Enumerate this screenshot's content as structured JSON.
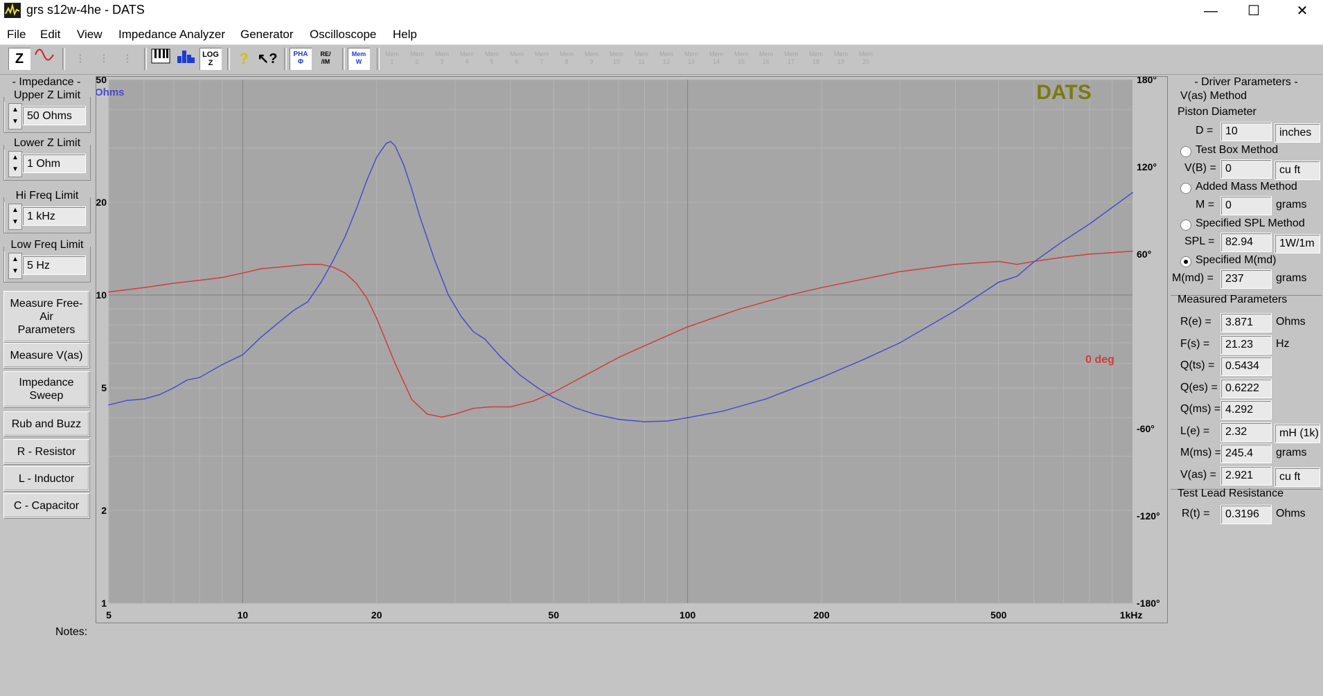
{
  "window": {
    "title": "grs s12w-4he - DATS",
    "minimize": "—",
    "maximize": "☐",
    "close": "✕"
  },
  "menu": [
    "File",
    "Edit",
    "View",
    "Impedance Analyzer",
    "Generator",
    "Oscilloscope",
    "Help"
  ],
  "toolbar": {
    "z_label": "Z",
    "mem_labels": [
      "Mem 1",
      "Mem 2",
      "Mem 3",
      "Mem 4",
      "Mem 5",
      "Mem 6",
      "Mem 7",
      "Mem 8",
      "Mem 9",
      "Mem 10",
      "Mem 11",
      "Mem 12",
      "Mem 13",
      "Mem 14",
      "Mem 15",
      "Mem 16",
      "Mem 17",
      "Mem 18",
      "Mem 19",
      "Mem 20"
    ]
  },
  "left_panel": {
    "impedance_header": "- Impedance -",
    "upper_z": {
      "title": "Upper Z Limit",
      "value": "50 Ohms"
    },
    "lower_z": {
      "title": "Lower Z Limit",
      "value": "1 Ohm"
    },
    "hi_freq": {
      "title": "Hi Freq Limit",
      "value": "1 kHz"
    },
    "low_freq": {
      "title": "Low Freq Limit",
      "value": "5 Hz"
    },
    "buttons": [
      "Measure Free-Air Parameters",
      "Measure V(as)",
      "Impedance Sweep",
      "Rub and Buzz",
      "R - Resistor",
      "L - Inductor",
      "C - Capacitor"
    ]
  },
  "notes_label": "Notes:",
  "right_panel": {
    "header": "- Driver Parameters -",
    "vas_method": "V(as) Method",
    "piston_diameter": "Piston Diameter",
    "d": {
      "label": "D =",
      "value": "10",
      "unit": "inches"
    },
    "test_box": {
      "label": "Test Box Method",
      "field_label": "V(B) =",
      "value": "0",
      "unit": "cu ft",
      "selected": false
    },
    "added_mass": {
      "label": "Added Mass Method",
      "field_label": "M =",
      "value": "0",
      "unit": "grams",
      "selected": false
    },
    "specified_spl": {
      "label": "Specified SPL Method",
      "field_label": "SPL =",
      "value": "82.94",
      "unit": "1W/1m",
      "selected": false
    },
    "specified_mmd": {
      "label": "Specified M(md)",
      "field_label": "M(md) =",
      "value": "237",
      "unit": "grams",
      "selected": true
    },
    "measured_header": "Measured Parameters",
    "measured": [
      {
        "label": "R(e) =",
        "value": "3.871",
        "unit": "Ohms"
      },
      {
        "label": "F(s) =",
        "value": "21.23",
        "unit": "Hz"
      },
      {
        "label": "Q(ts) =",
        "value": "0.5434",
        "unit": ""
      },
      {
        "label": "Q(es) =",
        "value": "0.6222",
        "unit": ""
      },
      {
        "label": "Q(ms) =",
        "value": "4.292",
        "unit": ""
      },
      {
        "label": "L(e) =",
        "value": "2.32",
        "unit": "mH (1k)"
      },
      {
        "label": "M(ms) =",
        "value": "245.4",
        "unit": "grams"
      },
      {
        "label": "V(as) =",
        "value": "2.921",
        "unit": "cu ft"
      }
    ],
    "test_lead_header": "Test Lead Resistance",
    "rt": {
      "label": "R(t) =",
      "value": "0.3196",
      "unit": "Ohms"
    }
  },
  "chart_data": {
    "type": "line",
    "watermark": "DATS",
    "xlabel": "",
    "y_left_unit": "Ohms",
    "y_right_label": "0 deg",
    "x_scale": "log",
    "xlim": [
      5,
      1000
    ],
    "x_ticks": [
      {
        "v": 5,
        "label": "5"
      },
      {
        "v": 10,
        "label": "10"
      },
      {
        "v": 20,
        "label": "20"
      },
      {
        "v": 50,
        "label": "50"
      },
      {
        "v": 100,
        "label": "100"
      },
      {
        "v": 200,
        "label": "200"
      },
      {
        "v": 500,
        "label": "500"
      },
      {
        "v": 1000,
        "label": "1kHz"
      }
    ],
    "y_left_scale": "log",
    "ylim_left": [
      1,
      50
    ],
    "y_left_ticks": [
      {
        "v": 1,
        "label": "1"
      },
      {
        "v": 2,
        "label": "2"
      },
      {
        "v": 5,
        "label": "5"
      },
      {
        "v": 10,
        "label": "10"
      },
      {
        "v": 20,
        "label": "20"
      },
      {
        "v": 50,
        "label": "50"
      }
    ],
    "ylim_right": [
      -180,
      180
    ],
    "y_right_ticks": [
      {
        "v": 180,
        "label": "180°"
      },
      {
        "v": 120,
        "label": "120°"
      },
      {
        "v": 60,
        "label": "60°"
      },
      {
        "v": -60,
        "label": "-60°"
      },
      {
        "v": -120,
        "label": "-120°"
      },
      {
        "v": -180,
        "label": "-180°"
      }
    ],
    "grid": true,
    "colors": {
      "impedance": "#4a4ad0",
      "phase": "#d03c3c",
      "watermark": "#7a7a10",
      "plot_bg": "#a6a6a6"
    },
    "series": [
      {
        "name": "",
        "axis": "left",
        "x": [
          5,
          5.5,
          6,
          6.5,
          7,
          7.5,
          8,
          9,
          10,
          11,
          12,
          13,
          14,
          15,
          16,
          17,
          18,
          19,
          20,
          21,
          21.5,
          22,
          23,
          24,
          25,
          27,
          29,
          31,
          33,
          35,
          38,
          42,
          46,
          50,
          56,
          62,
          70,
          80,
          90,
          100,
          120,
          150,
          200,
          250,
          300,
          400,
          500,
          550,
          600,
          700,
          800,
          1000
        ],
        "y": [
          4.4,
          4.55,
          4.6,
          4.75,
          5.0,
          5.3,
          5.4,
          5.95,
          6.4,
          7.3,
          8.1,
          8.9,
          9.5,
          11.0,
          13.0,
          15.5,
          19.0,
          23.5,
          28.0,
          31.0,
          31.5,
          30.5,
          26.5,
          22.0,
          18.0,
          13.0,
          10.0,
          8.5,
          7.6,
          7.2,
          6.3,
          5.5,
          5.0,
          4.65,
          4.3,
          4.1,
          3.95,
          3.88,
          3.9,
          4.0,
          4.2,
          4.6,
          5.4,
          6.2,
          7.0,
          8.9,
          11.0,
          11.5,
          12.8,
          15.0,
          17.0,
          21.5
        ]
      },
      {
        "name": "",
        "axis": "right",
        "x": [
          5,
          6,
          7,
          8,
          9,
          10,
          11,
          12,
          13,
          14,
          15,
          16,
          17,
          18,
          19,
          20,
          22,
          24,
          26,
          28,
          30,
          33,
          36,
          40,
          45,
          50,
          60,
          70,
          80,
          100,
          130,
          170,
          200,
          250,
          300,
          400,
          500,
          550,
          600,
          700,
          800,
          1000
        ],
        "y": [
          34,
          37,
          40,
          42,
          44,
          47,
          50,
          51,
          52,
          53,
          53,
          51,
          47,
          40,
          30,
          16,
          -15,
          -40,
          -50,
          -52,
          -50,
          -46,
          -45,
          -45,
          -41,
          -35,
          -22,
          -11,
          -3,
          10,
          22,
          32,
          37,
          43,
          48,
          53,
          55,
          53,
          55,
          58,
          60,
          62
        ]
      }
    ]
  }
}
